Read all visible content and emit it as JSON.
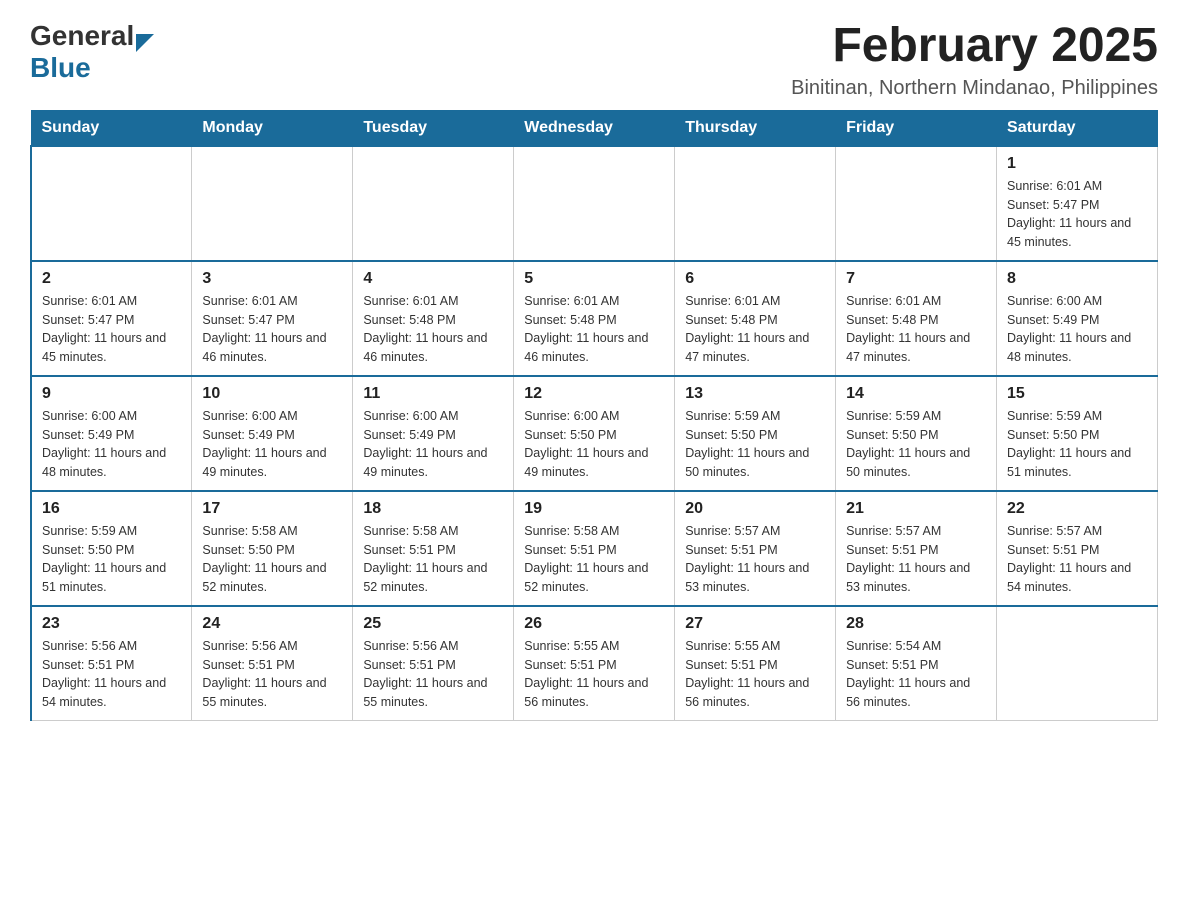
{
  "logo": {
    "text_general": "General",
    "text_blue": "Blue"
  },
  "title": {
    "month_year": "February 2025",
    "location": "Binitinan, Northern Mindanao, Philippines"
  },
  "days_of_week": [
    "Sunday",
    "Monday",
    "Tuesday",
    "Wednesday",
    "Thursday",
    "Friday",
    "Saturday"
  ],
  "weeks": [
    [
      {
        "day": "",
        "sunrise": "",
        "sunset": "",
        "daylight": ""
      },
      {
        "day": "",
        "sunrise": "",
        "sunset": "",
        "daylight": ""
      },
      {
        "day": "",
        "sunrise": "",
        "sunset": "",
        "daylight": ""
      },
      {
        "day": "",
        "sunrise": "",
        "sunset": "",
        "daylight": ""
      },
      {
        "day": "",
        "sunrise": "",
        "sunset": "",
        "daylight": ""
      },
      {
        "day": "",
        "sunrise": "",
        "sunset": "",
        "daylight": ""
      },
      {
        "day": "1",
        "sunrise": "Sunrise: 6:01 AM",
        "sunset": "Sunset: 5:47 PM",
        "daylight": "Daylight: 11 hours and 45 minutes."
      }
    ],
    [
      {
        "day": "2",
        "sunrise": "Sunrise: 6:01 AM",
        "sunset": "Sunset: 5:47 PM",
        "daylight": "Daylight: 11 hours and 45 minutes."
      },
      {
        "day": "3",
        "sunrise": "Sunrise: 6:01 AM",
        "sunset": "Sunset: 5:47 PM",
        "daylight": "Daylight: 11 hours and 46 minutes."
      },
      {
        "day": "4",
        "sunrise": "Sunrise: 6:01 AM",
        "sunset": "Sunset: 5:48 PM",
        "daylight": "Daylight: 11 hours and 46 minutes."
      },
      {
        "day": "5",
        "sunrise": "Sunrise: 6:01 AM",
        "sunset": "Sunset: 5:48 PM",
        "daylight": "Daylight: 11 hours and 46 minutes."
      },
      {
        "day": "6",
        "sunrise": "Sunrise: 6:01 AM",
        "sunset": "Sunset: 5:48 PM",
        "daylight": "Daylight: 11 hours and 47 minutes."
      },
      {
        "day": "7",
        "sunrise": "Sunrise: 6:01 AM",
        "sunset": "Sunset: 5:48 PM",
        "daylight": "Daylight: 11 hours and 47 minutes."
      },
      {
        "day": "8",
        "sunrise": "Sunrise: 6:00 AM",
        "sunset": "Sunset: 5:49 PM",
        "daylight": "Daylight: 11 hours and 48 minutes."
      }
    ],
    [
      {
        "day": "9",
        "sunrise": "Sunrise: 6:00 AM",
        "sunset": "Sunset: 5:49 PM",
        "daylight": "Daylight: 11 hours and 48 minutes."
      },
      {
        "day": "10",
        "sunrise": "Sunrise: 6:00 AM",
        "sunset": "Sunset: 5:49 PM",
        "daylight": "Daylight: 11 hours and 49 minutes."
      },
      {
        "day": "11",
        "sunrise": "Sunrise: 6:00 AM",
        "sunset": "Sunset: 5:49 PM",
        "daylight": "Daylight: 11 hours and 49 minutes."
      },
      {
        "day": "12",
        "sunrise": "Sunrise: 6:00 AM",
        "sunset": "Sunset: 5:50 PM",
        "daylight": "Daylight: 11 hours and 49 minutes."
      },
      {
        "day": "13",
        "sunrise": "Sunrise: 5:59 AM",
        "sunset": "Sunset: 5:50 PM",
        "daylight": "Daylight: 11 hours and 50 minutes."
      },
      {
        "day": "14",
        "sunrise": "Sunrise: 5:59 AM",
        "sunset": "Sunset: 5:50 PM",
        "daylight": "Daylight: 11 hours and 50 minutes."
      },
      {
        "day": "15",
        "sunrise": "Sunrise: 5:59 AM",
        "sunset": "Sunset: 5:50 PM",
        "daylight": "Daylight: 11 hours and 51 minutes."
      }
    ],
    [
      {
        "day": "16",
        "sunrise": "Sunrise: 5:59 AM",
        "sunset": "Sunset: 5:50 PM",
        "daylight": "Daylight: 11 hours and 51 minutes."
      },
      {
        "day": "17",
        "sunrise": "Sunrise: 5:58 AM",
        "sunset": "Sunset: 5:50 PM",
        "daylight": "Daylight: 11 hours and 52 minutes."
      },
      {
        "day": "18",
        "sunrise": "Sunrise: 5:58 AM",
        "sunset": "Sunset: 5:51 PM",
        "daylight": "Daylight: 11 hours and 52 minutes."
      },
      {
        "day": "19",
        "sunrise": "Sunrise: 5:58 AM",
        "sunset": "Sunset: 5:51 PM",
        "daylight": "Daylight: 11 hours and 52 minutes."
      },
      {
        "day": "20",
        "sunrise": "Sunrise: 5:57 AM",
        "sunset": "Sunset: 5:51 PM",
        "daylight": "Daylight: 11 hours and 53 minutes."
      },
      {
        "day": "21",
        "sunrise": "Sunrise: 5:57 AM",
        "sunset": "Sunset: 5:51 PM",
        "daylight": "Daylight: 11 hours and 53 minutes."
      },
      {
        "day": "22",
        "sunrise": "Sunrise: 5:57 AM",
        "sunset": "Sunset: 5:51 PM",
        "daylight": "Daylight: 11 hours and 54 minutes."
      }
    ],
    [
      {
        "day": "23",
        "sunrise": "Sunrise: 5:56 AM",
        "sunset": "Sunset: 5:51 PM",
        "daylight": "Daylight: 11 hours and 54 minutes."
      },
      {
        "day": "24",
        "sunrise": "Sunrise: 5:56 AM",
        "sunset": "Sunset: 5:51 PM",
        "daylight": "Daylight: 11 hours and 55 minutes."
      },
      {
        "day": "25",
        "sunrise": "Sunrise: 5:56 AM",
        "sunset": "Sunset: 5:51 PM",
        "daylight": "Daylight: 11 hours and 55 minutes."
      },
      {
        "day": "26",
        "sunrise": "Sunrise: 5:55 AM",
        "sunset": "Sunset: 5:51 PM",
        "daylight": "Daylight: 11 hours and 56 minutes."
      },
      {
        "day": "27",
        "sunrise": "Sunrise: 5:55 AM",
        "sunset": "Sunset: 5:51 PM",
        "daylight": "Daylight: 11 hours and 56 minutes."
      },
      {
        "day": "28",
        "sunrise": "Sunrise: 5:54 AM",
        "sunset": "Sunset: 5:51 PM",
        "daylight": "Daylight: 11 hours and 56 minutes."
      },
      {
        "day": "",
        "sunrise": "",
        "sunset": "",
        "daylight": ""
      }
    ]
  ]
}
